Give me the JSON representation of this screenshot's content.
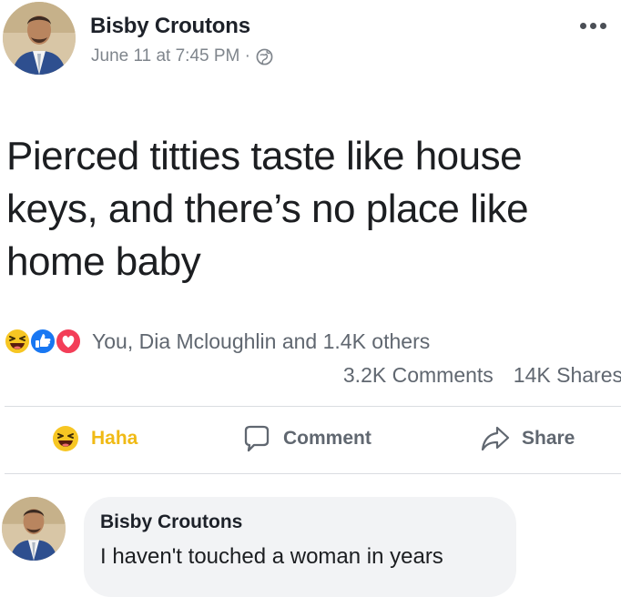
{
  "post": {
    "author": "Bisby Croutons",
    "timestamp": "June 11 at 7:45 PM · ",
    "privacy_icon": "globe-icon",
    "more_icon": "more-options-icon",
    "text": "Pierced titties taste like house keys, and there’s no place like home baby"
  },
  "reactions": {
    "icons": [
      "haha-reaction-icon",
      "like-reaction-icon",
      "love-reaction-icon"
    ],
    "names": "You, Dia Mcloughlin and 1.4K others",
    "comments": "3.2K Comments",
    "shares": "14K Shares"
  },
  "actions": {
    "haha_label": "Haha",
    "comment_label": "Comment",
    "share_label": "Share"
  },
  "comment": {
    "author": "Bisby Croutons",
    "text": "I haven't touched a woman in years"
  },
  "colors": {
    "haha": "#f0ba15",
    "like": "#1877f2",
    "love": "#f33e58",
    "muted_text": "#606770",
    "divider": "#dadde1"
  }
}
